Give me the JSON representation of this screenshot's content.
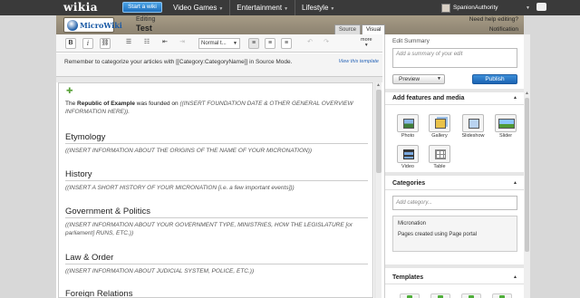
{
  "global_nav": {
    "logo": "wikia",
    "start_wiki_label": "Start a wiki",
    "hubs": [
      {
        "label": "Video Games"
      },
      {
        "label": "Entertainment"
      },
      {
        "label": "Lifestyle"
      }
    ],
    "username": "SpanionAuthority"
  },
  "edit_header": {
    "wiki_logo_text": "MicroWiki",
    "editing_label": "Editing",
    "page_title": "Test",
    "help_link": "Need help editing?",
    "notifications_label": "Notification",
    "tabs": [
      {
        "label": "Source",
        "active": false
      },
      {
        "label": "Visual",
        "active": true
      }
    ]
  },
  "toolbar": {
    "bold_label": "B",
    "italic_label": "i",
    "format_select_value": "Normal t...",
    "more_label": "more"
  },
  "category_note": {
    "text": "Remember to categorize your articles with [[Category:CategoryName]] in Source Mode.",
    "link_text": "View this template"
  },
  "article": {
    "intro_prefix": "The ",
    "intro_bold": "Republic of Example",
    "intro_mid": " was founded on ",
    "intro_italic": "((INSERT FOUNDATION DATE & OTHER GENERAL OVERVIEW INFORMATION HERE)).",
    "sections": [
      {
        "heading": "Etymology",
        "body": "((INSERT INFORMATION ABOUT THE ORIGINS OF THE NAME OF YOUR MICRONATION))"
      },
      {
        "heading": "History",
        "body": "((INSERT A SHORT HISTORY OF YOUR MICRONATION [i.e. a few important events]))"
      },
      {
        "heading": "Government & Politics",
        "body": "((INSERT INFORMATION ABOUT YOUR GOVERNMENT TYPE, MINISTRIES, HOW THE LEGISLATURE [or parliament] RUNS, ETC.))"
      },
      {
        "heading": "Law & Order",
        "body": "((INSERT INFORMATION ABOUT JUDICIAL SYSTEM, POLICE, ETC.))"
      },
      {
        "heading": "Foreign Relations",
        "body": ""
      }
    ]
  },
  "rail": {
    "summary_label": "Edit Summary",
    "summary_placeholder": "Add a summary of your edit",
    "preview_label": "Preview",
    "publish_label": "Publish",
    "features_title": "Add features and media",
    "media": [
      {
        "label": "Photo",
        "icon": "photo-icon"
      },
      {
        "label": "Gallery",
        "icon": "gallery-icon"
      },
      {
        "label": "Slideshow",
        "icon": "slideshow-icon"
      },
      {
        "label": "Slider",
        "icon": "slider-icon"
      },
      {
        "label": "Video",
        "icon": "video-icon"
      },
      {
        "label": "Table",
        "icon": "table-icon"
      }
    ],
    "categories_title": "Categories",
    "category_placeholder": "Add category...",
    "categories": [
      "Micronation",
      "Pages created using Page portal"
    ],
    "templates_title": "Templates"
  },
  "colors": {
    "nav_bg": "#3a3a3a",
    "accent_blue": "#1b63b2",
    "header_bg": "#a79c86"
  }
}
